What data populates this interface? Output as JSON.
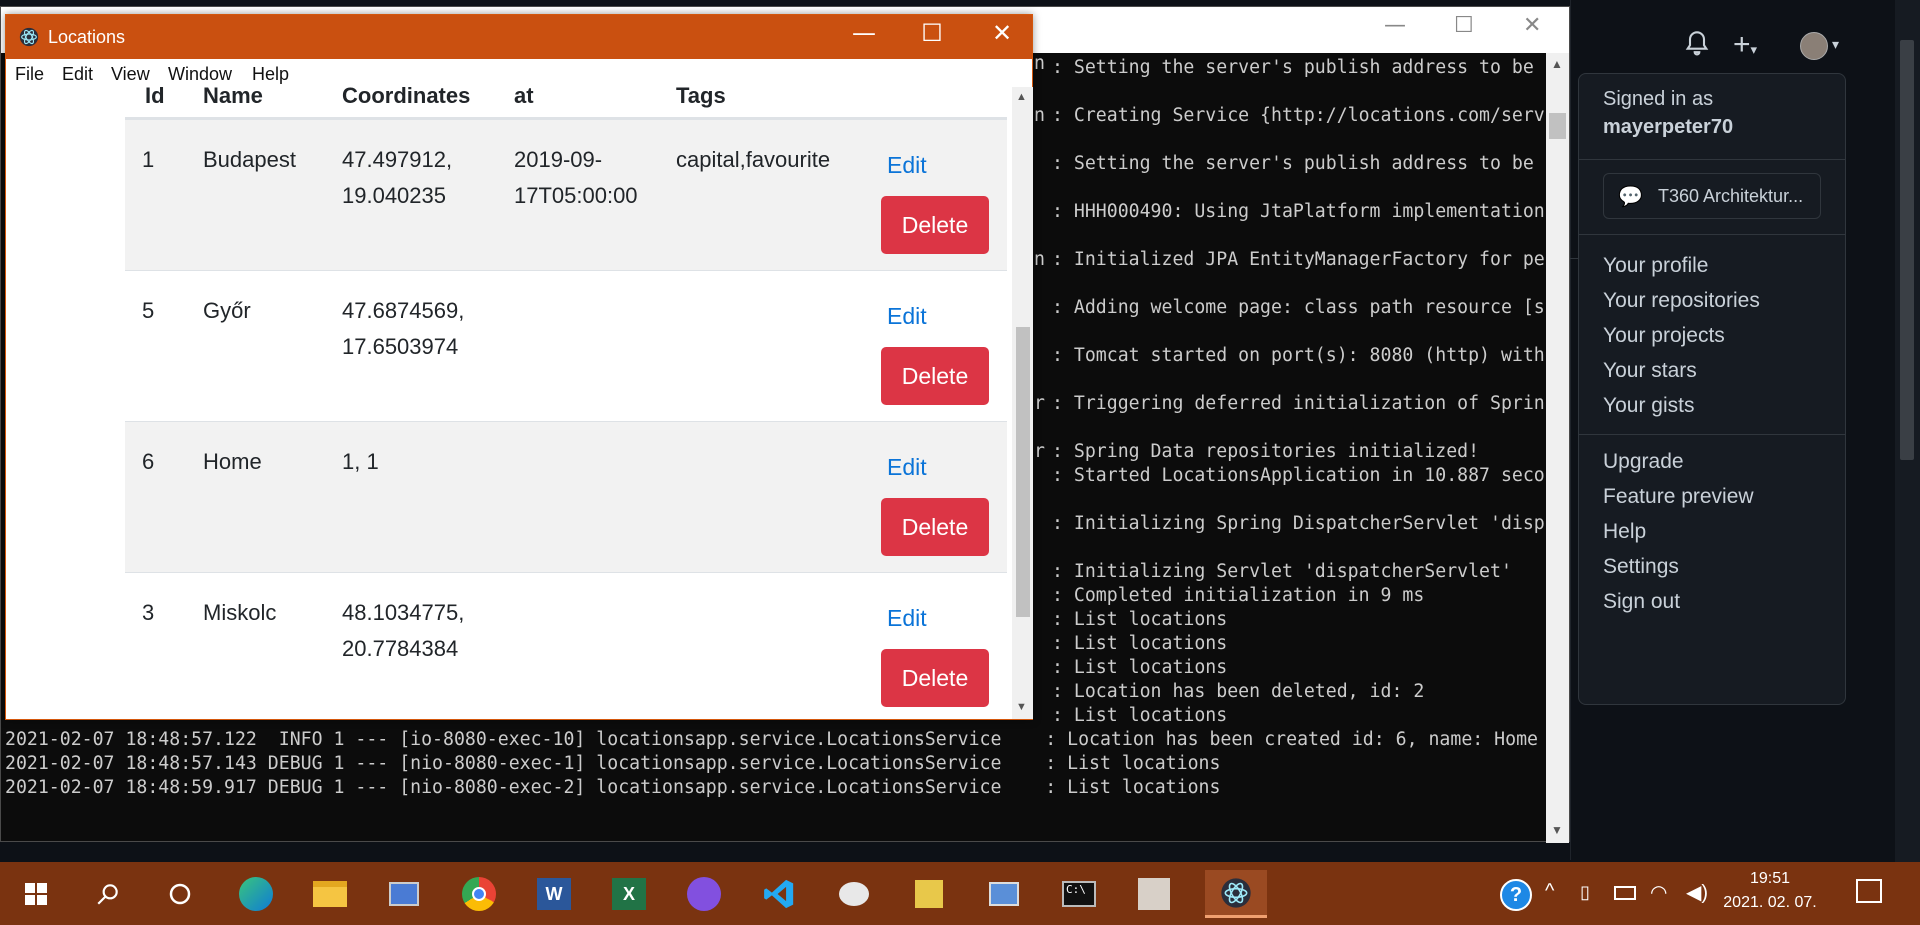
{
  "console": {
    "log_lines": [
      ": Setting the server's publish address to be",
      ": Creating Service {http://locations.com/serv",
      ": Setting the server's publish address to be",
      ": HHH000490: Using JtaPlatform implementation",
      ": Initialized JPA EntityManagerFactory for pe",
      ": Adding welcome page: class path resource [s",
      ": Tomcat started on port(s): 8080 (http) with",
      ": Triggering deferred initialization of Sprin",
      ": Spring Data repositories initialized!",
      ": Started LocationsApplication in 10.887 seco",
      ": Initializing Spring DispatcherServlet 'disp",
      ": Initializing Servlet 'dispatcherServlet'",
      ": Completed initialization in 9 ms",
      ": List locations",
      ": List locations",
      ": List locations",
      ": Location has been deleted, id: 2",
      ": List locations"
    ],
    "full_lines": [
      "2021-02-07 18:48:57.122  INFO 1 --- [io-8080-exec-10] locationsapp.service.LocationsService    : Location has been created id: 6, name: Home",
      "2021-02-07 18:48:57.143 DEBUG 1 --- [nio-8080-exec-1] locationsapp.service.LocationsService    : List locations",
      "2021-02-07 18:48:59.917 DEBUG 1 --- [nio-8080-exec-2] locationsapp.service.LocationsService    : List locations"
    ],
    "edge_chars": [
      "n",
      "r",
      "r"
    ]
  },
  "app": {
    "title": "Locations",
    "menu": [
      "File",
      "Edit",
      "View",
      "Window",
      "Help"
    ],
    "headers": [
      "Id",
      "Name",
      "Coordinates",
      "at",
      "Tags"
    ],
    "rows": [
      {
        "id": "1",
        "name": "Budapest",
        "coord1": "47.497912,",
        "coord2": "19.040235",
        "at1": "2019-09-",
        "at2": "17T05:00:00",
        "tags": "capital,favourite",
        "edit": "Edit",
        "delete": "Delete"
      },
      {
        "id": "5",
        "name": "Győr",
        "coord1": "47.6874569,",
        "coord2": "17.6503974",
        "at1": "",
        "at2": "",
        "tags": "",
        "edit": "Edit",
        "delete": "Delete"
      },
      {
        "id": "6",
        "name": "Home",
        "coord1": "1, 1",
        "coord2": "",
        "at1": "",
        "at2": "",
        "tags": "",
        "edit": "Edit",
        "delete": "Delete"
      },
      {
        "id": "3",
        "name": "Miskolc",
        "coord1": "48.1034775,",
        "coord2": "20.7784384",
        "at1": "",
        "at2": "",
        "tags": "",
        "edit": "Edit",
        "delete": "Delete"
      }
    ]
  },
  "github": {
    "signed_in_label": "Signed in as",
    "username": "mayerpeter70",
    "status": "T360 Architektur...",
    "menu1": [
      "Your profile",
      "Your repositories",
      "Your projects",
      "Your stars",
      "Your gists"
    ],
    "menu2": [
      "Upgrade",
      "Feature preview",
      "Help",
      "Settings",
      "Sign out"
    ]
  },
  "taskbar": {
    "time": "19:51",
    "date": "2021. 02. 07.",
    "help_icon": "?"
  }
}
